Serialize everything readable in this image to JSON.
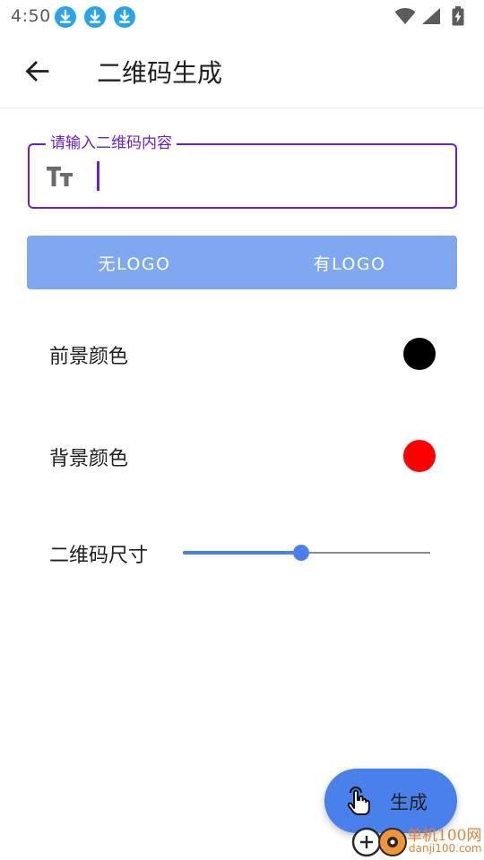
{
  "status_bar": {
    "time": "4:50",
    "notification_icons": [
      "download-icon",
      "download-icon",
      "download-icon"
    ],
    "system_icons": [
      "wifi-icon",
      "signal-icon",
      "battery-charging-icon"
    ]
  },
  "app_bar": {
    "back_icon": "arrow-back-icon",
    "title": "二维码生成"
  },
  "input": {
    "label": "请输入二维码内容",
    "value": "",
    "icon": "text-size-icon",
    "accent_color": "#6a1fd4"
  },
  "logo_toggle": {
    "options": [
      "无LOGO",
      "有LOGO"
    ],
    "background": "#80a8f0"
  },
  "foreground": {
    "label": "前景颜色",
    "color": "#000000"
  },
  "background": {
    "label": "背景颜色",
    "color": "#ff0000"
  },
  "size": {
    "label": "二维码尺寸",
    "value_fraction": 0.48
  },
  "fab": {
    "label": "生成",
    "icon": "touch-icon",
    "color": "#4a80ec"
  },
  "watermark": {
    "text1": "单机100网",
    "text2": "danji100.com"
  }
}
